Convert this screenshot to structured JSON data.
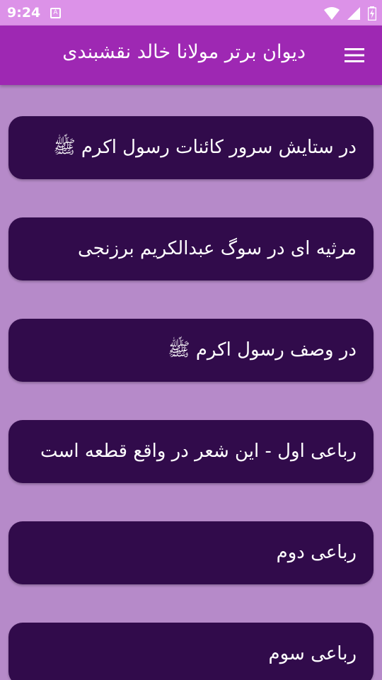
{
  "status_bar": {
    "time": "9:24",
    "notification_icon": "A",
    "icons": [
      "wifi-icon",
      "cell-signal-icon",
      "battery-charging-icon"
    ]
  },
  "app_bar": {
    "title": "دیوان برتر مولانا خالد نقشبندی",
    "menu_icon": "hamburger-menu-icon"
  },
  "colors": {
    "status_bar": "#dc92e8",
    "app_bar": "#9e28b3",
    "background": "#b68ac9",
    "card": "#310b4b",
    "text": "#ffffff"
  },
  "items": [
    {
      "label": "در ستایش سرور کائنات رسول اکرم ﷺ"
    },
    {
      "label": "مرثیه ای در سوگ عبدالکریم برزنجی"
    },
    {
      "label": "در وصف رسول اکرم ﷺ"
    },
    {
      "label": "رباعی اول - این شعر در واقع قطعه است"
    },
    {
      "label": "رباعی دوم"
    },
    {
      "label": "رباعی سوم"
    }
  ]
}
